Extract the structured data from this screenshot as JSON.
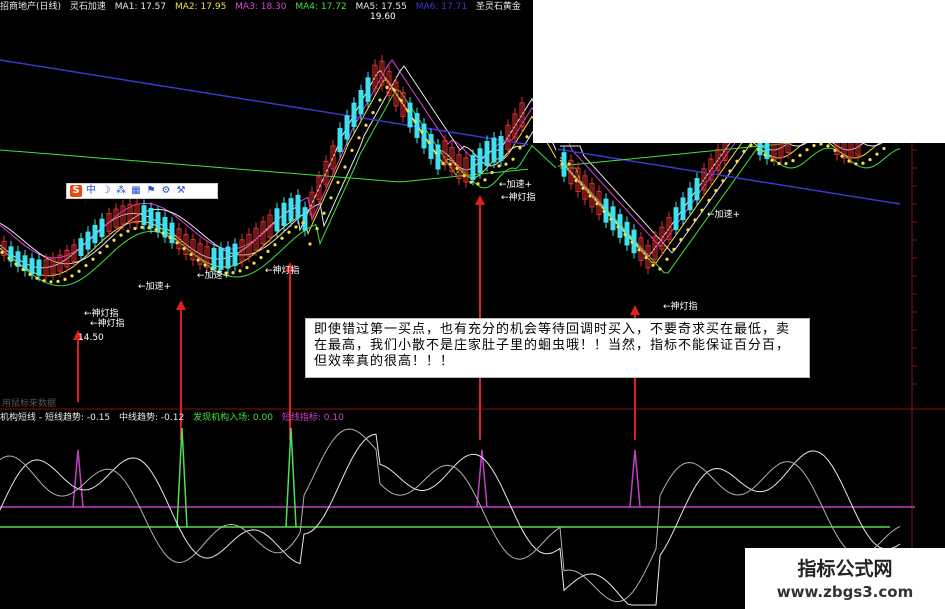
{
  "header": {
    "stock": "招商地产(日线)",
    "indicator": "灵石加速",
    "ma": [
      {
        "label": "MA1: 17.57",
        "color": "#e8e8e8"
      },
      {
        "label": "MA2: 17.95",
        "color": "#f0e040"
      },
      {
        "label": "MA3: 18.30",
        "color": "#e040e0"
      },
      {
        "label": "MA4: 17.72",
        "color": "#40e040"
      },
      {
        "label": "MA5: 17.55",
        "color": "#e8e8e8"
      },
      {
        "label": "MA6: 17.71",
        "color": "#3a3ad8"
      }
    ],
    "right_title": "圣灵石黄金"
  },
  "price_labels": {
    "high": "19.60",
    "low": "14.50"
  },
  "toolbar": {
    "items": [
      "S",
      "中",
      "☽",
      "⁂",
      "▦",
      "⚑",
      "⚙",
      "⚒"
    ]
  },
  "signals": [
    {
      "label": "神灯指",
      "arrow": "←"
    },
    {
      "label": "神灯指",
      "arrow": "←"
    },
    {
      "label": "加速+",
      "arrow": "←"
    },
    {
      "label": "加速+",
      "arrow": "←"
    },
    {
      "label": "神灯指",
      "arrow": "←"
    },
    {
      "label": "加速+",
      "arrow": "←"
    },
    {
      "label": "神灯指",
      "arrow": "←"
    },
    {
      "label": "加速+",
      "arrow": "←"
    },
    {
      "label": "神灯指",
      "arrow": "←"
    }
  ],
  "callout": {
    "text": "即使错过第一买点，也有充分的机会等待回调时买入，不要奇求买在最低，卖在最高，我们小散不是庄家肚子里的蛔虫哦！！当然，指标不能保证百分百，但效率真的很高！！！"
  },
  "sub_header": {
    "faded_label": "用鼠标来数据",
    "items": [
      {
        "label": "机构短线 - 短线趋势: -0.15",
        "color": "#e8e8e8"
      },
      {
        "label": "中线趋势: -0.12",
        "color": "#e8e8e8"
      },
      {
        "label": "发现机构入场: 0.00",
        "color": "#40e040"
      },
      {
        "label": "短线指标: 0.10",
        "color": "#d040d0"
      }
    ]
  },
  "watermark": {
    "line1": "指标公式网",
    "line2": "www.zbgs3.com"
  },
  "colors": {
    "background": "#000000",
    "candle_up": "#e03030",
    "candle_down": "#40e0f0",
    "arrow": "#e02020",
    "dots": "#f0e040"
  }
}
